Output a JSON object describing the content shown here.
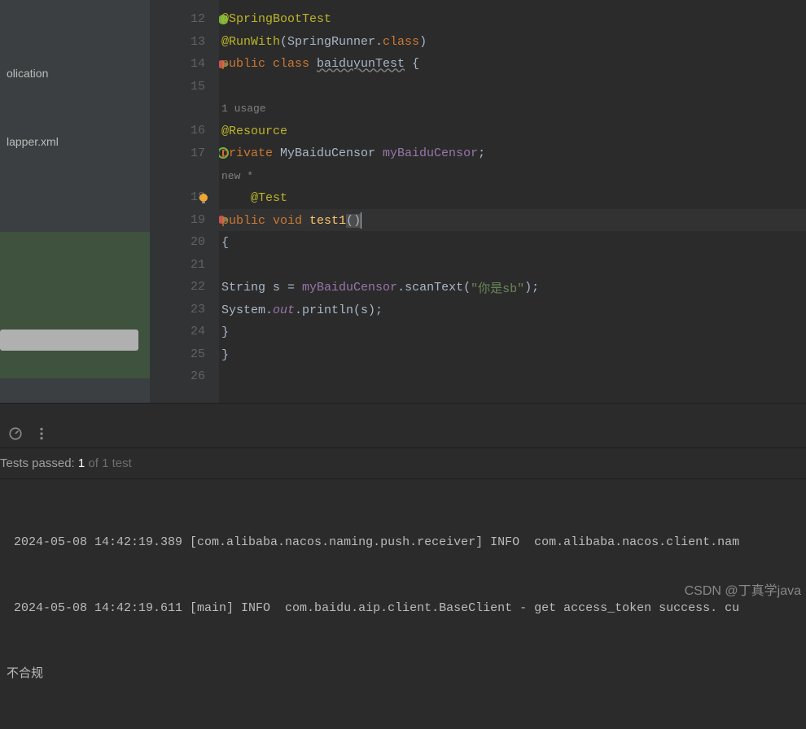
{
  "sidebar": {
    "item1": "olication",
    "item2": "lapper.xml"
  },
  "gutter": {
    "lines": [
      "12",
      "13",
      "14",
      "15",
      "16",
      "17",
      "18",
      "19",
      "20",
      "21",
      "22",
      "23",
      "24",
      "25",
      "26"
    ]
  },
  "code": {
    "l12": "@SpringBootTest",
    "l13_a": "@RunWith",
    "l13_b": "(SpringRunner.",
    "l13_c": "class",
    "l13_d": ")",
    "l14_a": "public class ",
    "l14_b": "baiduyunTest",
    "l14_c": " {",
    "hint_usages": "1 usage",
    "l16": "@Resource",
    "l17_a": "private ",
    "l17_b": "MyBaiduCensor ",
    "l17_c": "myBaiduCensor",
    "l17_d": ";",
    "hint_new": "new *",
    "l18": "@Test",
    "l19_a": "public void ",
    "l19_b": "test1",
    "l19_c": "(",
    "l19_d": ")",
    "l20": "{",
    "l22_a": "String s = ",
    "l22_b": "myBaiduCensor",
    "l22_c": ".scanText(",
    "l22_d": "\"你是sb\"",
    "l22_e": ");",
    "l23_a": "System.",
    "l23_b": "out",
    "l23_c": ".println(s);",
    "l24": "}",
    "l25": "}"
  },
  "tests": {
    "passed_label": "Tests passed: ",
    "passed_count": "1",
    "of_label": " of 1 test"
  },
  "console": {
    "line1": " 2024-05-08 14:42:19.389 [com.alibaba.nacos.naming.push.receiver] INFO  com.alibaba.nacos.client.nam",
    "line2": " 2024-05-08 14:42:19.611 [main] INFO  com.baidu.aip.client.BaseClient - get access_token success. cu",
    "line3": "不合规"
  },
  "watermark": "CSDN @丁真学java"
}
